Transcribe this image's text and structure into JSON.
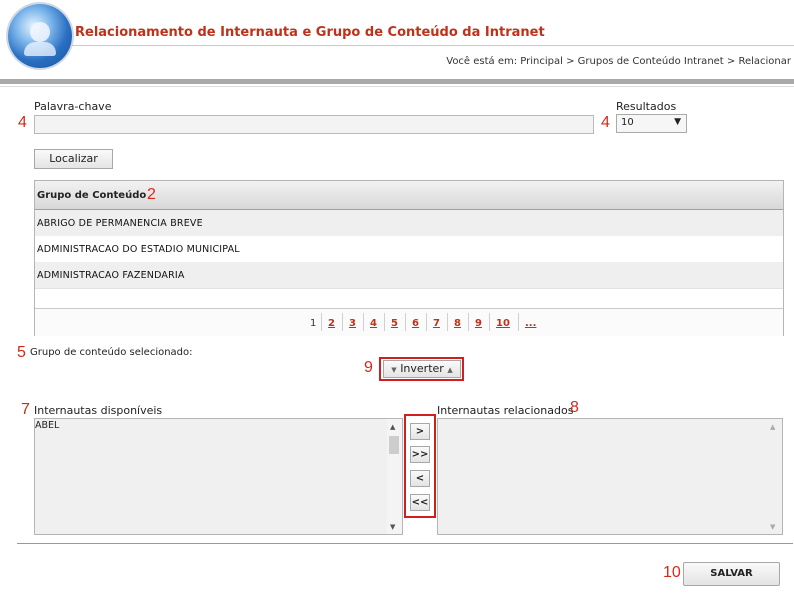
{
  "header": {
    "title": "Relacionamento de Internauta e Grupo de Conteúdo da Intranet",
    "breadcrumb": "Você está em: Principal > Grupos de Conteúdo Intranet > Relacionar"
  },
  "annotations": {
    "keyword": "4",
    "results": "4",
    "grid_header": "2",
    "selected_group": "5",
    "invert": "9",
    "available": "7",
    "related": "8",
    "save": "10"
  },
  "search": {
    "keyword_label": "Palavra-chave",
    "keyword_value": "",
    "results_label": "Resultados",
    "results_value": "10",
    "search_button": "Localizar"
  },
  "grid": {
    "column_header": "Grupo de Conteúdo",
    "rows": [
      "ABRIGO DE PERMANENCIA BREVE",
      "ADMINISTRACAO DO ESTADIO MUNICIPAL",
      "ADMINISTRACAO FAZENDARIA"
    ],
    "pagination": {
      "current": "1",
      "pages": [
        "2",
        "3",
        "4",
        "5",
        "6",
        "7",
        "8",
        "9",
        "10",
        "..."
      ]
    }
  },
  "selection": {
    "selected_label": "Grupo de conteúdo selecionado:",
    "invert_button": "Inverter"
  },
  "lists": {
    "available_label": "Internautas disponíveis",
    "available_items": [
      "ABEL"
    ],
    "related_label": "Internautas relacionados",
    "related_items": []
  },
  "move_buttons": {
    "add": ">",
    "add_all": ">>",
    "remove": "<",
    "remove_all": "<<"
  },
  "footer": {
    "save_button": "SALVAR"
  }
}
